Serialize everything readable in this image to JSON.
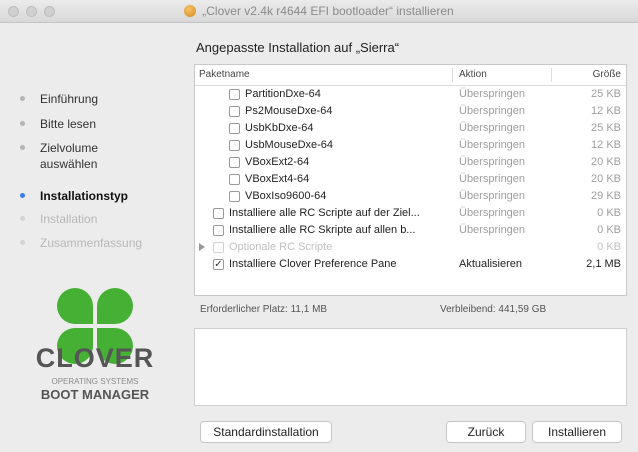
{
  "window": {
    "title": "„Clover v2.4k r4644 EFI bootloader“ installieren"
  },
  "sidebar": {
    "steps": [
      {
        "label": "Einführung",
        "state": "done"
      },
      {
        "label": "Bitte lesen",
        "state": "done"
      },
      {
        "label": "Zielvolume auswählen",
        "state": "done"
      },
      {
        "label": "Installationstyp",
        "state": "current"
      },
      {
        "label": "Installation",
        "state": "future"
      },
      {
        "label": "Zusammenfassung",
        "state": "future"
      }
    ],
    "brand": {
      "name": "CLOVER",
      "tagline_1": "OPERATING SYSTEMS",
      "tagline_2": "BOOT MANAGER"
    }
  },
  "main": {
    "heading": "Angepasste Installation auf „Sierra“",
    "columns": {
      "name": "Paketname",
      "action": "Aktion",
      "size": "Größe"
    },
    "rows": [
      {
        "name": "PartitionDxe-64",
        "action": "Überspringen",
        "size": "25 KB",
        "checked": false,
        "indent": 2
      },
      {
        "name": "Ps2MouseDxe-64",
        "action": "Überspringen",
        "size": "12 KB",
        "checked": false,
        "indent": 2
      },
      {
        "name": "UsbKbDxe-64",
        "action": "Überspringen",
        "size": "25 KB",
        "checked": false,
        "indent": 2
      },
      {
        "name": "UsbMouseDxe-64",
        "action": "Überspringen",
        "size": "12 KB",
        "checked": false,
        "indent": 2
      },
      {
        "name": "VBoxExt2-64",
        "action": "Überspringen",
        "size": "20 KB",
        "checked": false,
        "indent": 2
      },
      {
        "name": "VBoxExt4-64",
        "action": "Überspringen",
        "size": "20 KB",
        "checked": false,
        "indent": 2
      },
      {
        "name": "VBoxIso9600-64",
        "action": "Überspringen",
        "size": "29 KB",
        "checked": false,
        "indent": 2
      },
      {
        "name": "Installiere alle RC Scripte auf der Ziel...",
        "action": "Überspringen",
        "size": "0 KB",
        "checked": false,
        "indent": 1
      },
      {
        "name": "Installiere alle RC Skripte auf allen b...",
        "action": "Überspringen",
        "size": "0 KB",
        "checked": false,
        "indent": 1
      },
      {
        "name": "Optionale RC Scripte",
        "action": "",
        "size": "0 KB",
        "checked": false,
        "indent": 1,
        "disabled": true,
        "expandable": true
      },
      {
        "name": "Installiere Clover Preference Pane",
        "action": "Aktualisieren",
        "size": "2,1 MB",
        "checked": true,
        "indent": 1,
        "active": true
      }
    ],
    "required_space": "Erforderlicher Platz:  11,1 MB",
    "remaining_space": "Verbleibend:  441,59 GB"
  },
  "buttons": {
    "standard": "Standardinstallation",
    "back": "Zurück",
    "install": "Installieren"
  },
  "colors": {
    "accent": "#3b7cf2",
    "clover_green": "#45b034"
  }
}
